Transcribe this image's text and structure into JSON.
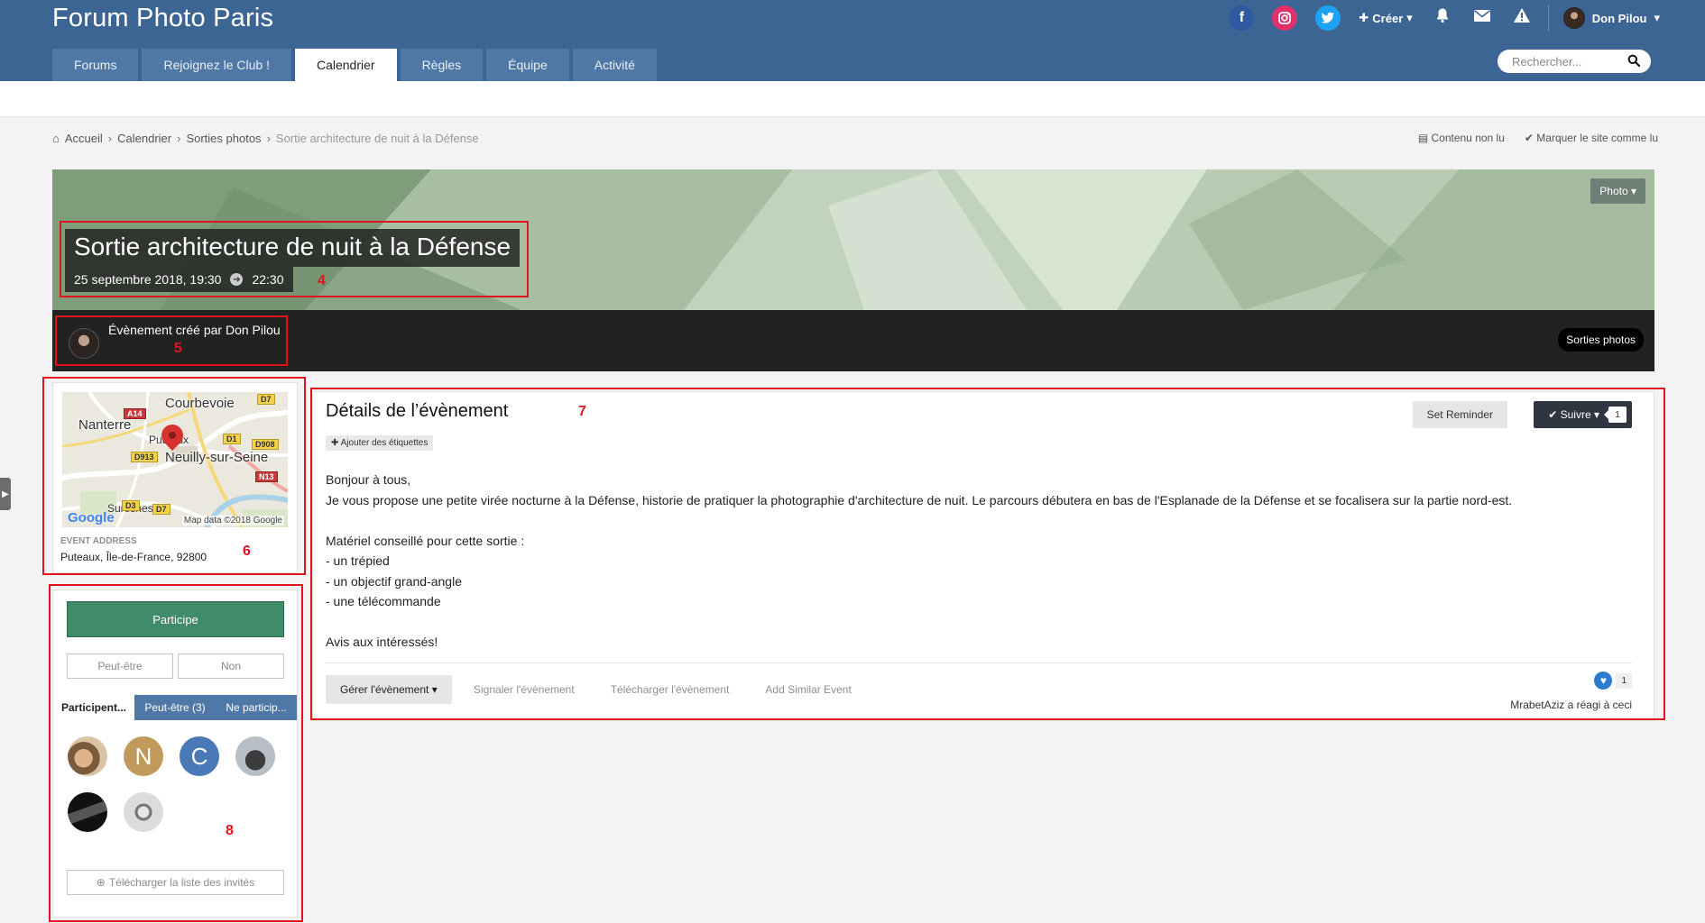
{
  "header": {
    "site_title": "Forum Photo Paris",
    "create_label": "Créer",
    "user_name": "Don Pilou",
    "search_placeholder": "Rechercher...",
    "tabs": [
      {
        "label": "Forums",
        "active": false
      },
      {
        "label": "Rejoignez le Club !",
        "active": false
      },
      {
        "label": "Calendrier",
        "active": true
      },
      {
        "label": "Règles",
        "active": false
      },
      {
        "label": "Équipe",
        "active": false
      },
      {
        "label": "Activité",
        "active": false
      }
    ],
    "icons": [
      "facebook-icon",
      "instagram-icon",
      "twitter-icon",
      "bell-icon",
      "envelope-icon",
      "warning-icon"
    ]
  },
  "breadcrumb": {
    "items": [
      "Accueil",
      "Calendrier",
      "Sorties photos",
      "Sortie architecture de nuit à la Défense"
    ]
  },
  "site_actions": {
    "unread": "Contenu non lu",
    "mark_read": "Marquer le site comme lu"
  },
  "event": {
    "photo_button": "Photo",
    "title": "Sortie architecture de nuit à la Défense",
    "start": "25 septembre 2018, 19:30",
    "end": "22:30",
    "creator_text": "Évènement créé par Don Pilou",
    "category": "Sorties photos"
  },
  "map": {
    "labels": {
      "courbevoie": "Courbevoie",
      "nanterre": "Nanterre",
      "puteaux": "Puteaux",
      "neuilly": "Neuilly-sur-Seine",
      "suresnes": "Suresnes"
    },
    "roads": {
      "d7a": "D7",
      "a14": "A14",
      "d1": "D1",
      "d908": "D908",
      "d913": "D913",
      "n13": "N13",
      "d3": "D3",
      "d7b": "D7"
    },
    "google": "Google",
    "attribution": "Map data ©2018 Google",
    "address_label": "EVENT ADDRESS",
    "address": "Puteaux, Île-de-France, 92800"
  },
  "rsvp": {
    "participate": "Participe",
    "maybe": "Peut-être",
    "no": "Non",
    "tabs": [
      "Participent...",
      "Peut-être (3)",
      "Ne particip..."
    ],
    "attendee_initials": {
      "n": "N",
      "c": "C"
    },
    "download_list": "Télécharger la liste des invités"
  },
  "details": {
    "heading": "Détails de l’évènement",
    "add_tags": "Ajouter des étiquettes",
    "set_reminder": "Set Reminder",
    "follow": "Suivre",
    "follow_count": "1",
    "body": [
      "Bonjour à tous,",
      "Je vous propose une petite virée nocturne à la Défense, historie de pratiquer la photographie d'architecture de nuit. Le parcours débutera en bas de l'Esplanade de la Défense et se focalisera sur la partie nord-est.",
      "",
      "Matériel conseillé pour cette sortie :",
      "- un trépied",
      "- un objectif grand-angle",
      "- une télécommande",
      "",
      "Avis aux intéressés!"
    ],
    "manage": "Gérer l'évènement",
    "report": "Signaler l'évènement",
    "download": "Télécharger l'évènement",
    "add_similar": "Add Similar Event",
    "reaction_count": "1",
    "reaction_text": "MrabetAziz a réagi à ceci"
  },
  "annotations": [
    "4",
    "5",
    "6",
    "7",
    "8"
  ],
  "colors": {
    "header_bg": "#3d6594",
    "tab_bg": "#5078a6",
    "participate_green": "#3f8b6a",
    "annotation_red": "#e0141e"
  }
}
